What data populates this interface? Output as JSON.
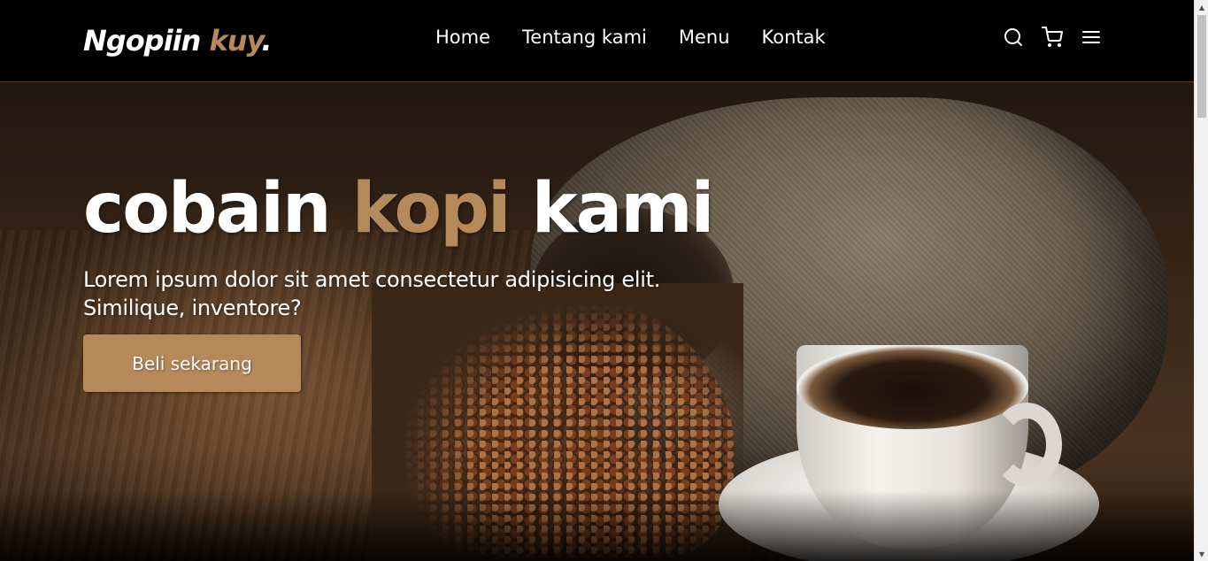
{
  "brand": {
    "logo_main": "Ngopiin ",
    "logo_accent": "kuy",
    "logo_dot": ".",
    "accent_color": "#b6895b"
  },
  "nav": {
    "links": [
      "Home",
      "Tentang kami",
      "Menu",
      "Kontak"
    ],
    "icons": [
      "search-icon",
      "shopping-cart-icon",
      "menu-icon"
    ]
  },
  "hero": {
    "title_part1": "cobain ",
    "title_accent": "kopi",
    "title_part2": " kami",
    "text": "Lorem ipsum dolor sit amet consectetur adipisicing elit. Similique, inventore?",
    "cta_label": "Beli sekarang"
  },
  "scrollbar": {
    "up_arrow": "▲",
    "down_arrow": "▼"
  }
}
